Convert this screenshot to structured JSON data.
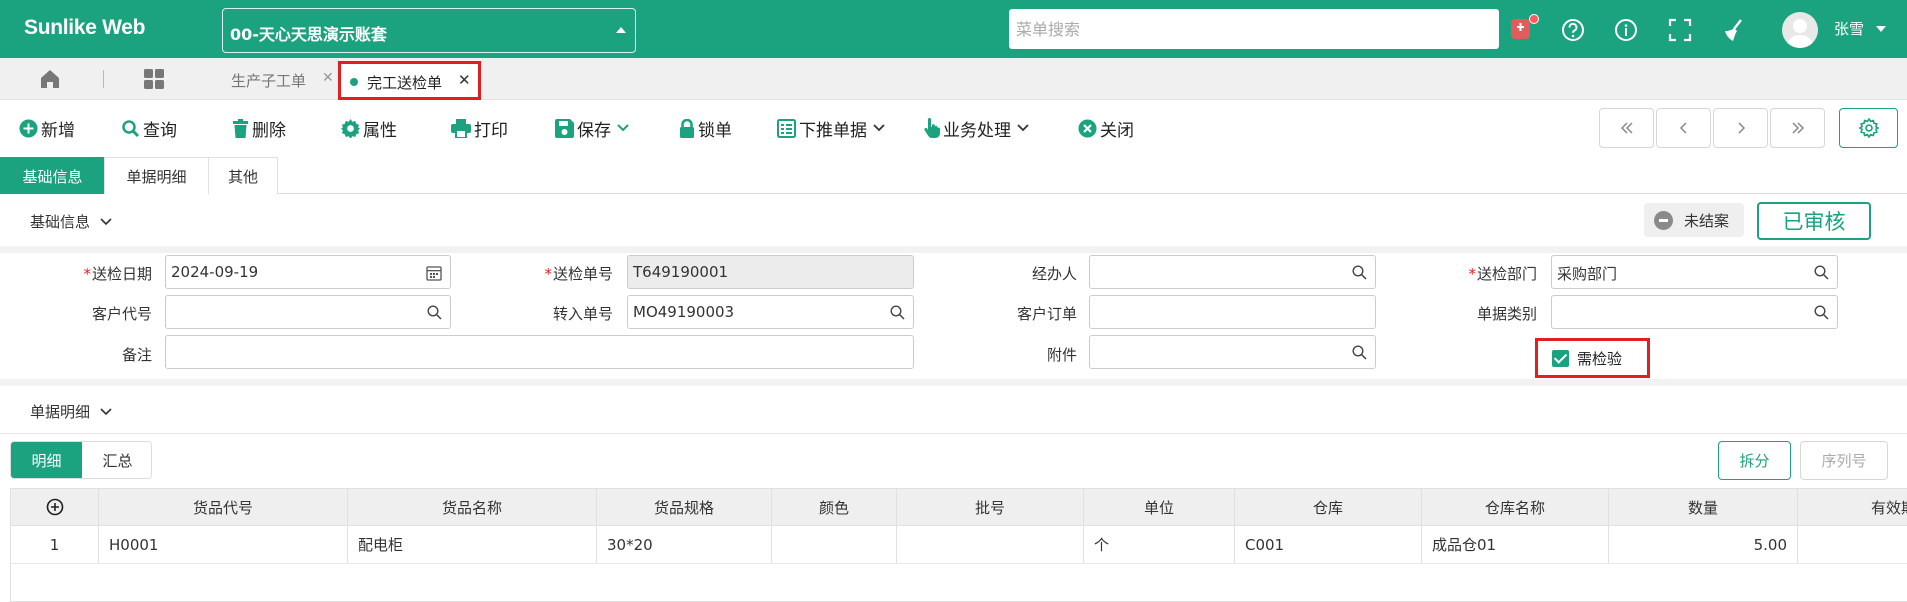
{
  "app": {
    "logo": "Sunlike Web",
    "account": "00-天心天思演示账套",
    "search_placeholder": "菜单搜索",
    "user": "张雪"
  },
  "tabs": {
    "tab1": "生产子工单",
    "tab2": "完工送检单"
  },
  "toolbar": {
    "new": "新增",
    "query": "查询",
    "delete": "删除",
    "props": "属性",
    "print": "打印",
    "save": "保存",
    "lock": "锁单",
    "push": "下推单据",
    "biz": "业务处理",
    "close": "关闭"
  },
  "section_tabs": [
    "基础信息",
    "单据明细",
    "其他"
  ],
  "basic": {
    "header": "基础信息",
    "status": "未结案",
    "approved": "已审核",
    "fields": {
      "date_label": "送检日期",
      "date_value": "2024-09-19",
      "no_label": "送检单号",
      "no_value": "T649190001",
      "handler_label": "经办人",
      "handler_value": "",
      "dept_label": "送检部门",
      "dept_value": "采购部门",
      "cust_label": "客户代号",
      "cust_value": "",
      "from_label": "转入单号",
      "from_value": "MO49190003",
      "order_label": "客户订单",
      "order_value": "",
      "type_label": "单据类别",
      "type_value": "",
      "note_label": "备注",
      "note_value": "",
      "attach_label": "附件",
      "attach_value": "",
      "inspect_label": "需检验"
    }
  },
  "detail": {
    "header": "单据明细",
    "subtabs": [
      "明细",
      "汇总"
    ],
    "split": "拆分",
    "serial": "序列号",
    "columns": [
      "货品代号",
      "货品名称",
      "货品规格",
      "颜色",
      "批号",
      "单位",
      "仓库",
      "仓库名称",
      "数量",
      "有效期"
    ],
    "rows": [
      {
        "no": "1",
        "code": "H0001",
        "name": "配电柜",
        "spec": "30*20",
        "color": "",
        "batch": "",
        "unit": "个",
        "wh": "C001",
        "wh_name": "成品仓01",
        "qty": "5.00",
        "exp": ""
      }
    ]
  }
}
